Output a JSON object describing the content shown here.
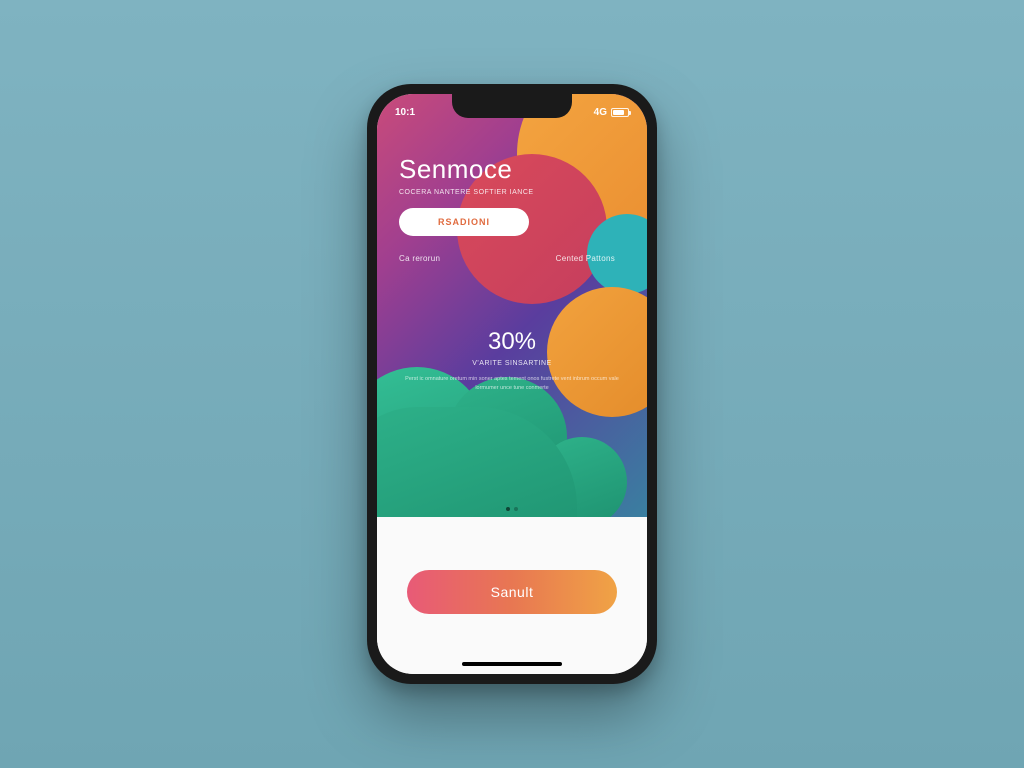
{
  "status": {
    "time": "10:1",
    "network": "4G"
  },
  "app": {
    "title": "Senmoce",
    "subtitle": "COCERA NANTERE SOFTIER IANCE",
    "pill_label": "RSADIONI"
  },
  "links": {
    "left": "Ca rerorun",
    "right": "Cented Pattons"
  },
  "metric": {
    "value": "30%",
    "label": "V'ARITE SINSARTINE",
    "desc": "Perst ic omnature oretum min soner aptes tement onos fustrete vent inbrum occum vale lormumer unce tune conmerte"
  },
  "cta": {
    "label": "Sanult"
  },
  "colors": {
    "accent_pink": "#e85a77",
    "accent_orange": "#f0a345",
    "green": "#2eb28a"
  }
}
